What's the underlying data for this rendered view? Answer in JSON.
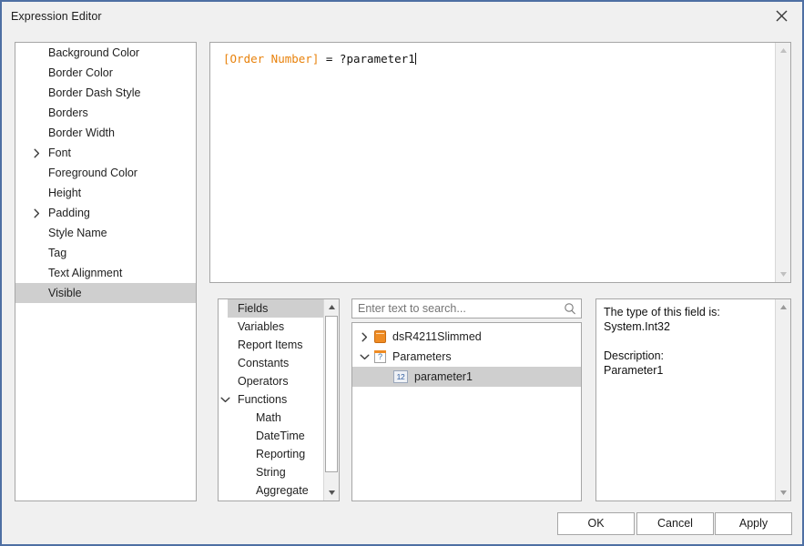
{
  "window": {
    "title": "Expression Editor",
    "close_label": "✕",
    "border_color": "#4e6fa3",
    "background": "#f0f0f0"
  },
  "properties_list": {
    "name": "properties-list",
    "selected": "Visible",
    "items": [
      {
        "label": "Background Color",
        "expandable": false,
        "expanded": false,
        "selected": false
      },
      {
        "label": "Border Color",
        "expandable": false,
        "expanded": false,
        "selected": false
      },
      {
        "label": "Border Dash Style",
        "expandable": false,
        "expanded": false,
        "selected": false
      },
      {
        "label": "Borders",
        "expandable": false,
        "expanded": false,
        "selected": false
      },
      {
        "label": "Border Width",
        "expandable": false,
        "expanded": false,
        "selected": false
      },
      {
        "label": "Font",
        "expandable": true,
        "expanded": false,
        "selected": false
      },
      {
        "label": "Foreground Color",
        "expandable": false,
        "expanded": false,
        "selected": false
      },
      {
        "label": "Height",
        "expandable": false,
        "expanded": false,
        "selected": false
      },
      {
        "label": "Padding",
        "expandable": true,
        "expanded": false,
        "selected": false
      },
      {
        "label": "Style Name",
        "expandable": false,
        "expanded": false,
        "selected": false
      },
      {
        "label": "Tag",
        "expandable": false,
        "expanded": false,
        "selected": false
      },
      {
        "label": "Text Alignment",
        "expandable": false,
        "expanded": false,
        "selected": false
      },
      {
        "label": "Visible",
        "expandable": false,
        "expanded": false,
        "selected": true
      }
    ]
  },
  "expression_editor": {
    "name": "expression-text-area",
    "field_token": "[Order Number]",
    "rest_token": " = ?parameter1",
    "full_text": "[Order Number] = ?parameter1",
    "field_token_color": "#e8820c",
    "text_color": "#111111",
    "scrollbar_enabled": false
  },
  "categories": {
    "name": "category-list",
    "selected": "Fields",
    "items": [
      {
        "label": "Fields",
        "indent": 0,
        "expandable": false,
        "expanded": false,
        "selected": true
      },
      {
        "label": "Variables",
        "indent": 0,
        "expandable": false,
        "expanded": false,
        "selected": false
      },
      {
        "label": "Report Items",
        "indent": 0,
        "expandable": false,
        "expanded": false,
        "selected": false
      },
      {
        "label": "Constants",
        "indent": 0,
        "expandable": false,
        "expanded": false,
        "selected": false
      },
      {
        "label": "Operators",
        "indent": 0,
        "expandable": false,
        "expanded": false,
        "selected": false
      },
      {
        "label": "Functions",
        "indent": 0,
        "expandable": true,
        "expanded": true,
        "selected": false
      },
      {
        "label": "Math",
        "indent": 1,
        "expandable": false,
        "expanded": false,
        "selected": false
      },
      {
        "label": "DateTime",
        "indent": 1,
        "expandable": false,
        "expanded": false,
        "selected": false
      },
      {
        "label": "Reporting",
        "indent": 1,
        "expandable": false,
        "expanded": false,
        "selected": false
      },
      {
        "label": "String",
        "indent": 1,
        "expandable": false,
        "expanded": false,
        "selected": false
      },
      {
        "label": "Aggregate",
        "indent": 1,
        "expandable": false,
        "expanded": false,
        "selected": false
      }
    ]
  },
  "search": {
    "name": "search-input",
    "placeholder": "Enter text to search...",
    "value": "",
    "icon": "search-icon"
  },
  "tree": {
    "name": "field-tree",
    "selected": "parameter1",
    "nodes": [
      {
        "label": "dsR4211Slimmed",
        "depth": 0,
        "expandable": true,
        "expanded": false,
        "icon": "dataset-icon",
        "selected": false
      },
      {
        "label": "Parameters",
        "depth": 0,
        "expandable": true,
        "expanded": true,
        "icon": "parameters-icon",
        "icon_glyph": "?",
        "selected": false
      },
      {
        "label": "parameter1",
        "depth": 1,
        "expandable": false,
        "expanded": false,
        "icon": "integer-field-icon",
        "icon_glyph": "12",
        "selected": true
      }
    ]
  },
  "description": {
    "name": "description-panel",
    "text": "The type of this field is:\nSystem.Int32\n\nDescription:\nParameter1",
    "type_label": "The type of this field is:",
    "type_value": "System.Int32",
    "description_label": "Description:",
    "description_value": "Parameter1"
  },
  "footer": {
    "ok_label": "OK",
    "cancel_label": "Cancel",
    "apply_label": "Apply"
  }
}
